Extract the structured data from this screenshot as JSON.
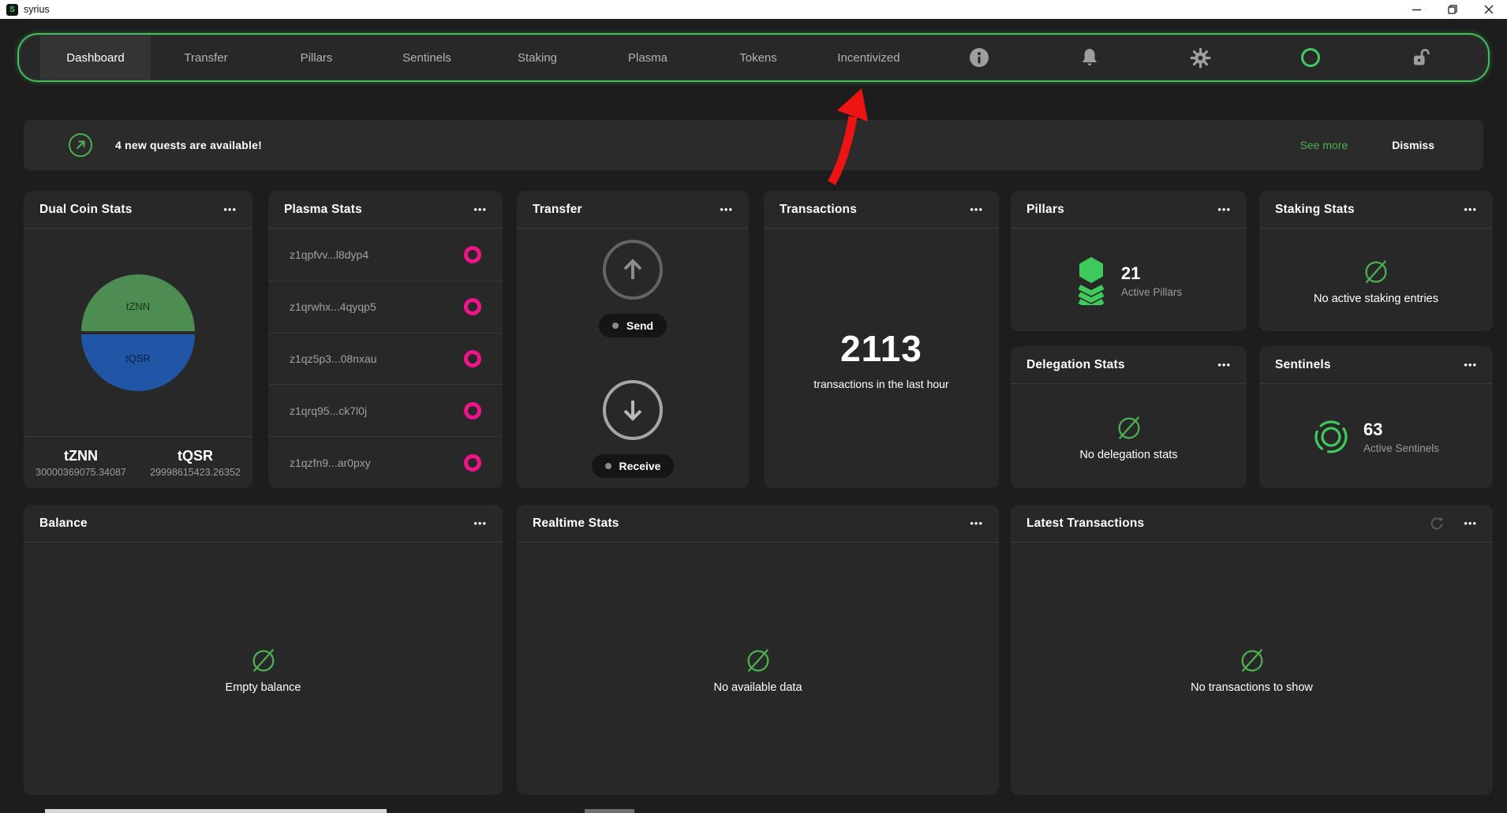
{
  "titlebar": {
    "app_name": "syrius"
  },
  "nav": {
    "active_tab": "Dashboard",
    "tabs": [
      {
        "label": "Dashboard"
      },
      {
        "label": "Transfer"
      },
      {
        "label": "Pillars"
      },
      {
        "label": "Sentinels"
      },
      {
        "label": "Staking"
      },
      {
        "label": "Plasma"
      },
      {
        "label": "Tokens"
      },
      {
        "label": "Incentivized"
      }
    ]
  },
  "banner": {
    "message": "4 new quests are available!",
    "see_more_label": "See more",
    "dismiss_label": "Dismiss"
  },
  "cards": {
    "dual_coin": {
      "title": "Dual Coin Stats",
      "legend": [
        {
          "symbol": "tZNN",
          "value": "30000369075.34087"
        },
        {
          "symbol": "tQSR",
          "value": "29998615423.26352"
        }
      ]
    },
    "plasma": {
      "title": "Plasma Stats",
      "rows": [
        "z1qpfvv...l8dyp4",
        "z1qrwhx...4qyqp5",
        "z1qz5p3...08nxau",
        "z1qrq95...ck7l0j",
        "z1qzfn9...ar0pxy"
      ]
    },
    "transfer": {
      "title": "Transfer",
      "send_label": "Send",
      "receive_label": "Receive"
    },
    "transactions": {
      "title": "Transactions",
      "count": "2113",
      "caption": "transactions in the last hour"
    },
    "pillars": {
      "title": "Pillars",
      "count": "21",
      "caption": "Active Pillars"
    },
    "delegation": {
      "title": "Delegation Stats",
      "empty": "No delegation stats"
    },
    "staking": {
      "title": "Staking Stats",
      "empty": "No active staking entries"
    },
    "sentinels": {
      "title": "Sentinels",
      "count": "63",
      "caption": "Active Sentinels"
    },
    "balance": {
      "title": "Balance",
      "empty": "Empty balance"
    },
    "realtime": {
      "title": "Realtime Stats",
      "empty": "No available data"
    },
    "latest_transactions": {
      "title": "Latest Transactions",
      "empty": "No transactions to show"
    }
  },
  "icons": {
    "more": "•••"
  },
  "chart_data": {
    "type": "pie",
    "title": "Dual Coin Stats",
    "labels": [
      "tZNN",
      "tQSR"
    ],
    "values": [
      30000369075.34087,
      29998615423.26352
    ],
    "colors": [
      "#4d8c52",
      "#2056a5"
    ],
    "legend_position": "bottom"
  },
  "colors": {
    "accent_green": "#45bb5d",
    "pink": "#f0138a",
    "pie_green": "#4d8c52",
    "pie_blue": "#2056a5",
    "arrow_red": "#ee1414"
  }
}
